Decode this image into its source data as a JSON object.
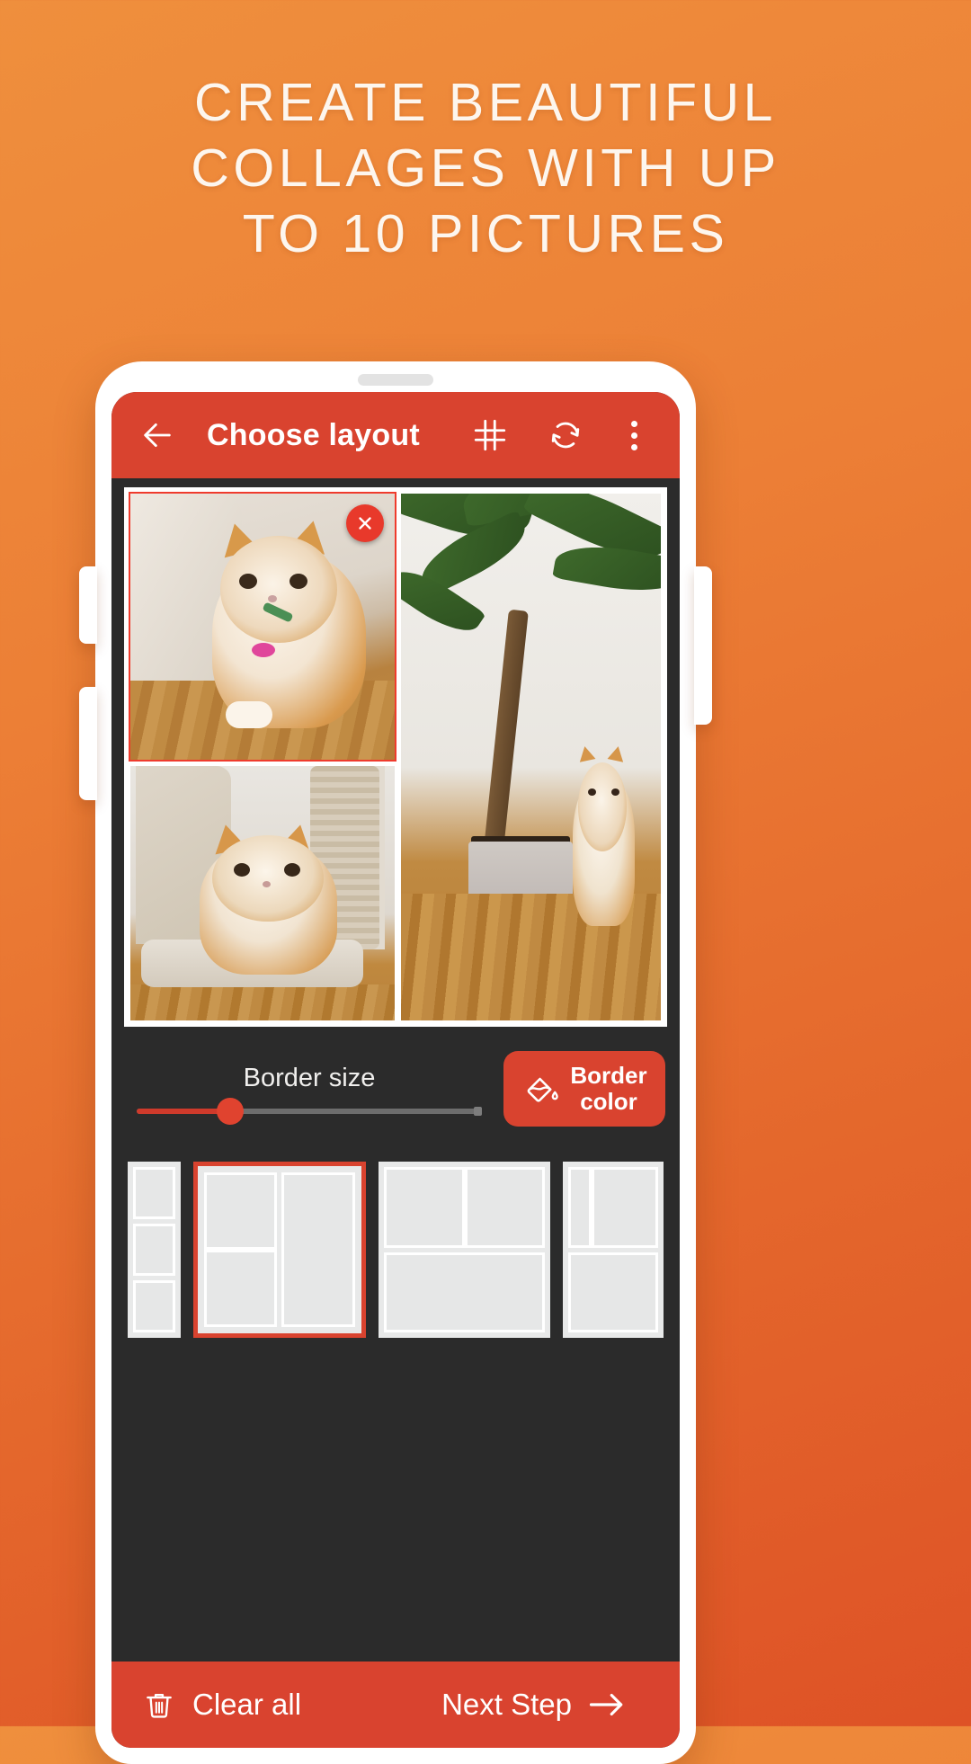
{
  "headline": {
    "line1": "CREATE BEAUTIFUL",
    "line2": "COLLAGES WITH UP",
    "line3": "TO 10 PICTURES"
  },
  "colors": {
    "background_start": "#ef8f3d",
    "background_end": "#de5226",
    "app_bar": "#d9432f",
    "accent_red": "#d9432f",
    "selection_red": "#ef3b2d",
    "panel_dark": "#2b2b2b",
    "thumbnail_grey": "#e8e9e9",
    "text_white": "#ffffff"
  },
  "app_bar": {
    "back_icon": "back-arrow-icon",
    "title": "Choose layout",
    "grid_icon": "grid-icon",
    "shuffle_icon": "refresh-shuffle-icon",
    "overflow_icon": "more-vertical-icon"
  },
  "collage": {
    "selected_cell_index": 0,
    "remove_icon": "close-icon",
    "cells": [
      {
        "name": "photo-cat-peeking",
        "selected": true
      },
      {
        "name": "photo-cat-scratching-post",
        "selected": false
      },
      {
        "name": "photo-plant-and-cat",
        "selected": false
      }
    ]
  },
  "border_controls": {
    "slider_label": "Border size",
    "slider_value_percent": 27,
    "slider_min": 0,
    "slider_max": 100,
    "border_color_button": {
      "icon": "paint-bucket-icon",
      "label_line1": "Border",
      "label_line2": "color"
    }
  },
  "layouts": {
    "selected_index": 1,
    "items": [
      {
        "name": "layout-3-stacked-rows",
        "cells": 3
      },
      {
        "name": "layout-2-left-1-right",
        "cells": 3
      },
      {
        "name": "layout-2-top-1-bottom",
        "cells": 3
      },
      {
        "name": "layout-2-top-1-bottom-narrow",
        "cells": 3
      }
    ]
  },
  "bottom_bar": {
    "clear_all_icon": "trash-icon",
    "clear_all_label": "Clear all",
    "next_step_label": "Next Step",
    "next_step_icon": "arrow-right-icon"
  }
}
